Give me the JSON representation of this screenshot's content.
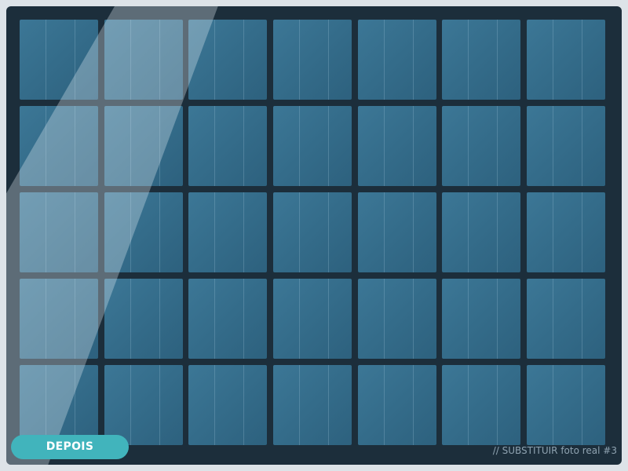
{
  "badge": {
    "label": "DEPOIS",
    "color": "#41b4bc"
  },
  "placeholder_note": "// SUBSTITUIR foto real #3",
  "panel_grid": {
    "rows": 5,
    "columns": 7,
    "frame_color": "#1c2e3b",
    "cell_color": "#346c8a"
  }
}
